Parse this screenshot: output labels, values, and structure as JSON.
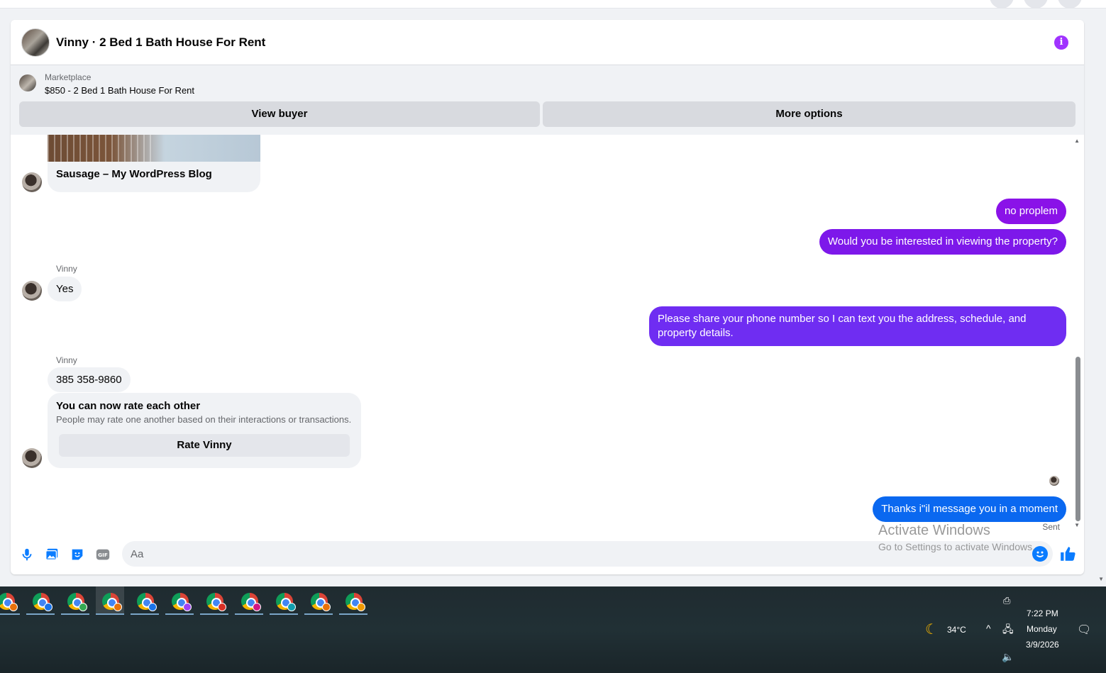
{
  "chat": {
    "title": "Vinny · 2 Bed 1 Bath House For Rent",
    "marketplace": {
      "label": "Marketplace",
      "listing": "$850 - 2 Bed 1 Bath House For Rent",
      "view_buyer": "View buyer",
      "more_options": "More options"
    },
    "messages": {
      "link_card_title": "Sausage – My WordPress Blog",
      "out_1": "no proplem",
      "out_2": "Would you be interested in viewing the property?",
      "sender_1": "Vinny",
      "in_1": "Yes",
      "out_3": "Please share your phone number so I can text you the address, schedule, and property details.",
      "sender_2": "Vinny",
      "in_2": "385 358-9860",
      "rate_title": "You can now rate each other",
      "rate_subtitle": "People may rate one another based on their interactions or transactions.",
      "rate_button": "Rate Vinny",
      "out_4": "Thanks i\"il message you in a moment",
      "status": "Sent"
    },
    "composer": {
      "placeholder": "Aa"
    },
    "colors": {
      "accent": "#0a7cff",
      "bubble_purple": "#8a12e8",
      "bubble_violet": "#6f2df2",
      "bubble_blue": "#0a68f0",
      "info": "#a033ff"
    }
  },
  "watermark": {
    "line1": "Activate Windows",
    "line2": "Go to Settings to activate Windows."
  },
  "taskbar": {
    "weather_temp": "34°C",
    "time": "7:22 PM",
    "day": "Monday",
    "date": "3/9/2026"
  }
}
